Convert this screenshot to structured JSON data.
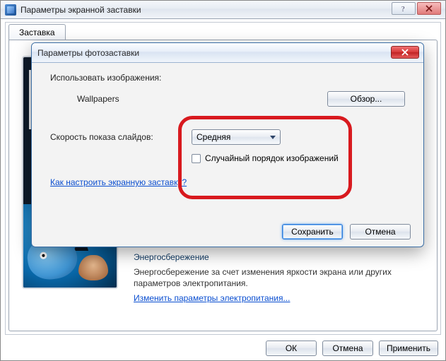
{
  "outer": {
    "title": "Параметры экранной заставки",
    "tab_label": "Заставка",
    "energy_heading": "Энергосбережение",
    "energy_text": "Энергосбережение за счет изменения яркости экрана или других параметров электропитания.",
    "energy_link": "Изменить параметры электропитания...",
    "buttons": {
      "ok": "ОК",
      "cancel": "Отмена",
      "apply": "Применить"
    }
  },
  "dialog": {
    "title": "Параметры фотозаставки",
    "use_images_label": "Использовать изображения:",
    "folder_name": "Wallpapers",
    "browse_label": "Обзор...",
    "speed_label": "Скорость показа слайдов:",
    "speed_value": "Средняя",
    "shuffle_label": "Случайный порядок изображений",
    "help_link": "Как настроить экранную заставку?",
    "save_label": "Сохранить",
    "cancel_label": "Отмена"
  }
}
